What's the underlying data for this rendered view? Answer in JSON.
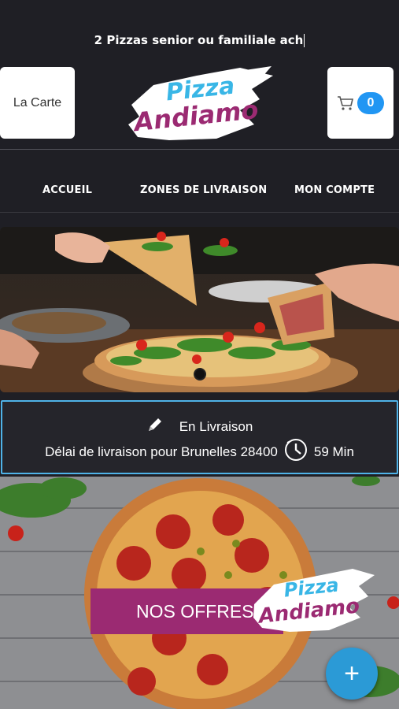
{
  "promo": {
    "text": "2 Pizzas senior ou familiale ach"
  },
  "header": {
    "menu_button": "La Carte",
    "cart_count": "0",
    "logo_line1": "Pizza",
    "logo_line2": "Andiamo"
  },
  "nav": {
    "items": [
      {
        "label": "ACCUEIL"
      },
      {
        "label": "ZONES DE LIVRAISON"
      },
      {
        "label": "MON COMPTE"
      }
    ]
  },
  "delivery": {
    "mode": "En Livraison",
    "delay_text": "Délai de livraison pour Brunelles 28400",
    "time": "59 Min"
  },
  "offers": {
    "label": "NOS OFFRES",
    "logo_line1": "Pizza",
    "logo_line2": "Andiamo"
  },
  "fab": {
    "symbol": "+"
  },
  "colors": {
    "background": "#1f1f25",
    "accent_blue": "#2196f3",
    "brand_purple": "#9b2a72",
    "brand_cyan": "#39b6e6"
  },
  "icons": [
    "cart-icon",
    "pencil-icon",
    "clock-icon",
    "plus-icon"
  ]
}
